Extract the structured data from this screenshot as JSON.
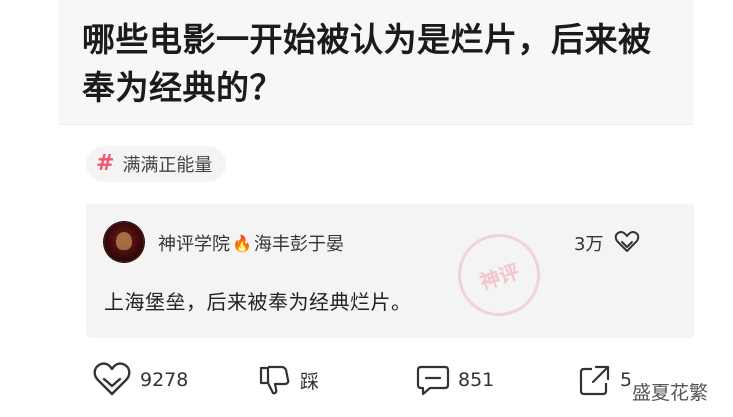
{
  "question": {
    "title": "哪些电影一开始被认为是烂片，后来被奉为经典的？"
  },
  "tag": {
    "icon": "hash-icon",
    "label": "满满正能量",
    "color": "#f2566c"
  },
  "top_comment": {
    "author_prefix": "神评学院",
    "author_suffix": "海丰彭于晏",
    "likes": "3万",
    "text": "上海堡垒，后来被奉为经典烂片。",
    "stamp_text": "神评"
  },
  "actions": {
    "like_count": "9278",
    "dislike_label": "踩",
    "comment_count": "851",
    "share_count": "5"
  },
  "watermark": "盛夏花繁"
}
